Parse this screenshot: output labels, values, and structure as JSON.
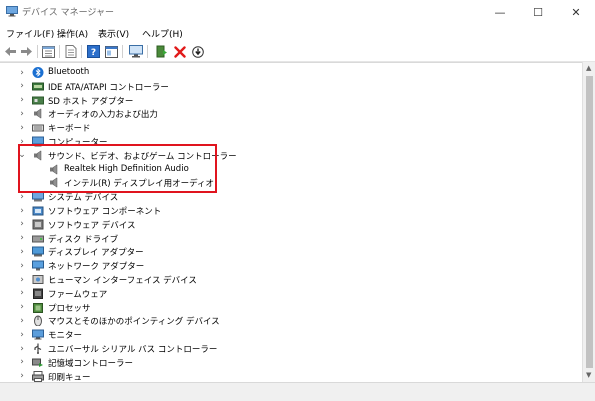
{
  "window": {
    "title": "デバイス マネージャー",
    "controls": [
      "—",
      "☐",
      "✕"
    ]
  },
  "menu": [
    "ファイル(F)",
    "操作(A)",
    "表示(V)",
    "ヘルプ(H)"
  ],
  "toolbar": {
    "icons": [
      "back-arrow-icon",
      "forward-arrow-icon",
      "properties-grid-icon",
      "document-icon",
      "help-icon",
      "console-icon",
      "monitor-scan-icon",
      "add-driver-icon",
      "delete-x-icon",
      "download-icon"
    ]
  },
  "tree": {
    "items": [
      {
        "label": "Bluetooth",
        "icon": "bluetooth-icon"
      },
      {
        "label": "IDE ATA/ATAPI コントローラー",
        "icon": "ide-controller-icon"
      },
      {
        "label": "SD ホスト アダプター",
        "icon": "sd-host-icon"
      },
      {
        "label": "オーディオの入力および出力",
        "icon": "speaker-icon"
      },
      {
        "label": "キーボード",
        "icon": "keyboard-icon"
      },
      {
        "label": "コンピューター",
        "icon": "computer-icon"
      },
      {
        "label": "サウンド、ビデオ、およびゲーム コントローラー",
        "icon": "speaker-icon",
        "expanded": true
      },
      {
        "label": "Realtek High Definition Audio",
        "icon": "speaker-icon",
        "child": true
      },
      {
        "label": "インテル(R) ディスプレイ用オーディオ",
        "icon": "speaker-icon",
        "child": true
      },
      {
        "label": "システム デバイス",
        "icon": "system-device-icon"
      },
      {
        "label": "ソフトウェア コンポーネント",
        "icon": "software-component-icon"
      },
      {
        "label": "ソフトウェア デバイス",
        "icon": "software-device-icon"
      },
      {
        "label": "ディスク ドライブ",
        "icon": "disk-drive-icon"
      },
      {
        "label": "ディスプレイ アダプター",
        "icon": "display-adapter-icon"
      },
      {
        "label": "ネットワーク アダプター",
        "icon": "network-adapter-icon"
      },
      {
        "label": "ヒューマン インターフェイス デバイス",
        "icon": "hid-icon"
      },
      {
        "label": "ファームウェア",
        "icon": "firmware-icon"
      },
      {
        "label": "プロセッサ",
        "icon": "processor-icon"
      },
      {
        "label": "マウスとそのほかのポインティング デバイス",
        "icon": "mouse-icon"
      },
      {
        "label": "モニター",
        "icon": "monitor-icon"
      },
      {
        "label": "ユニバーサル シリアル バス コントローラー",
        "icon": "usb-icon"
      },
      {
        "label": "記憶域コントローラー",
        "icon": "storage-controller-icon"
      },
      {
        "label": "印刷キュー",
        "icon": "printer-icon"
      }
    ]
  },
  "colors": {
    "highlight": "#e0141e",
    "bluetooth": "#1a6fd1",
    "delete": "#e11a1a",
    "accent": "#1f6fc6"
  }
}
